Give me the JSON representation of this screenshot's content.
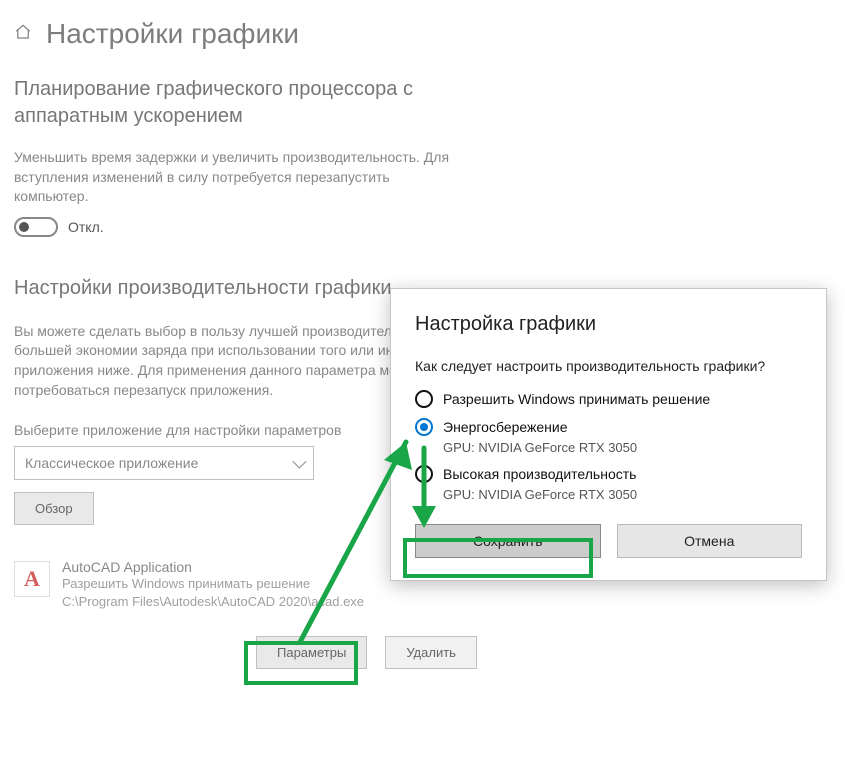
{
  "page": {
    "title": "Настройки графики"
  },
  "hw_scheduling": {
    "heading": "Планирование графического процессора с аппаратным ускорением",
    "description": "Уменьшить время задержки и увеличить производительность. Для вступления изменений в силу потребуется перезапустить компьютер.",
    "toggle_label": "Откл."
  },
  "perf": {
    "heading": "Настройки производительности графики",
    "description": "Вы можете сделать выбор в пользу лучшей производительности или большей экономии заряда при использовании того или иного приложения ниже. Для применения данного параметра может потребоваться перезапуск приложения.",
    "select_label": "Выберите приложение для настройки параметров",
    "select_value": "Классическое приложение",
    "browse_label": "Обзор"
  },
  "app": {
    "icon_letter": "A",
    "name": "AutoCAD Application",
    "mode": "Разрешить Windows принимать решение",
    "path": "C:\\Program Files\\Autodesk\\AutoCAD 2020\\acad.exe",
    "params_label": "Параметры",
    "delete_label": "Удалить"
  },
  "dialog": {
    "title": "Настройка графики",
    "question": "Как следует настроить производительность графики?",
    "options": [
      {
        "label": "Разрешить Windows принимать решение",
        "sub": "",
        "selected": false
      },
      {
        "label": "Энергосбережение",
        "sub": "GPU: NVIDIA GeForce RTX 3050",
        "selected": true
      },
      {
        "label": "Высокая производительность",
        "sub": "GPU: NVIDIA GeForce RTX 3050",
        "selected": false
      }
    ],
    "save_label": "Сохранить",
    "cancel_label": "Отмена"
  }
}
